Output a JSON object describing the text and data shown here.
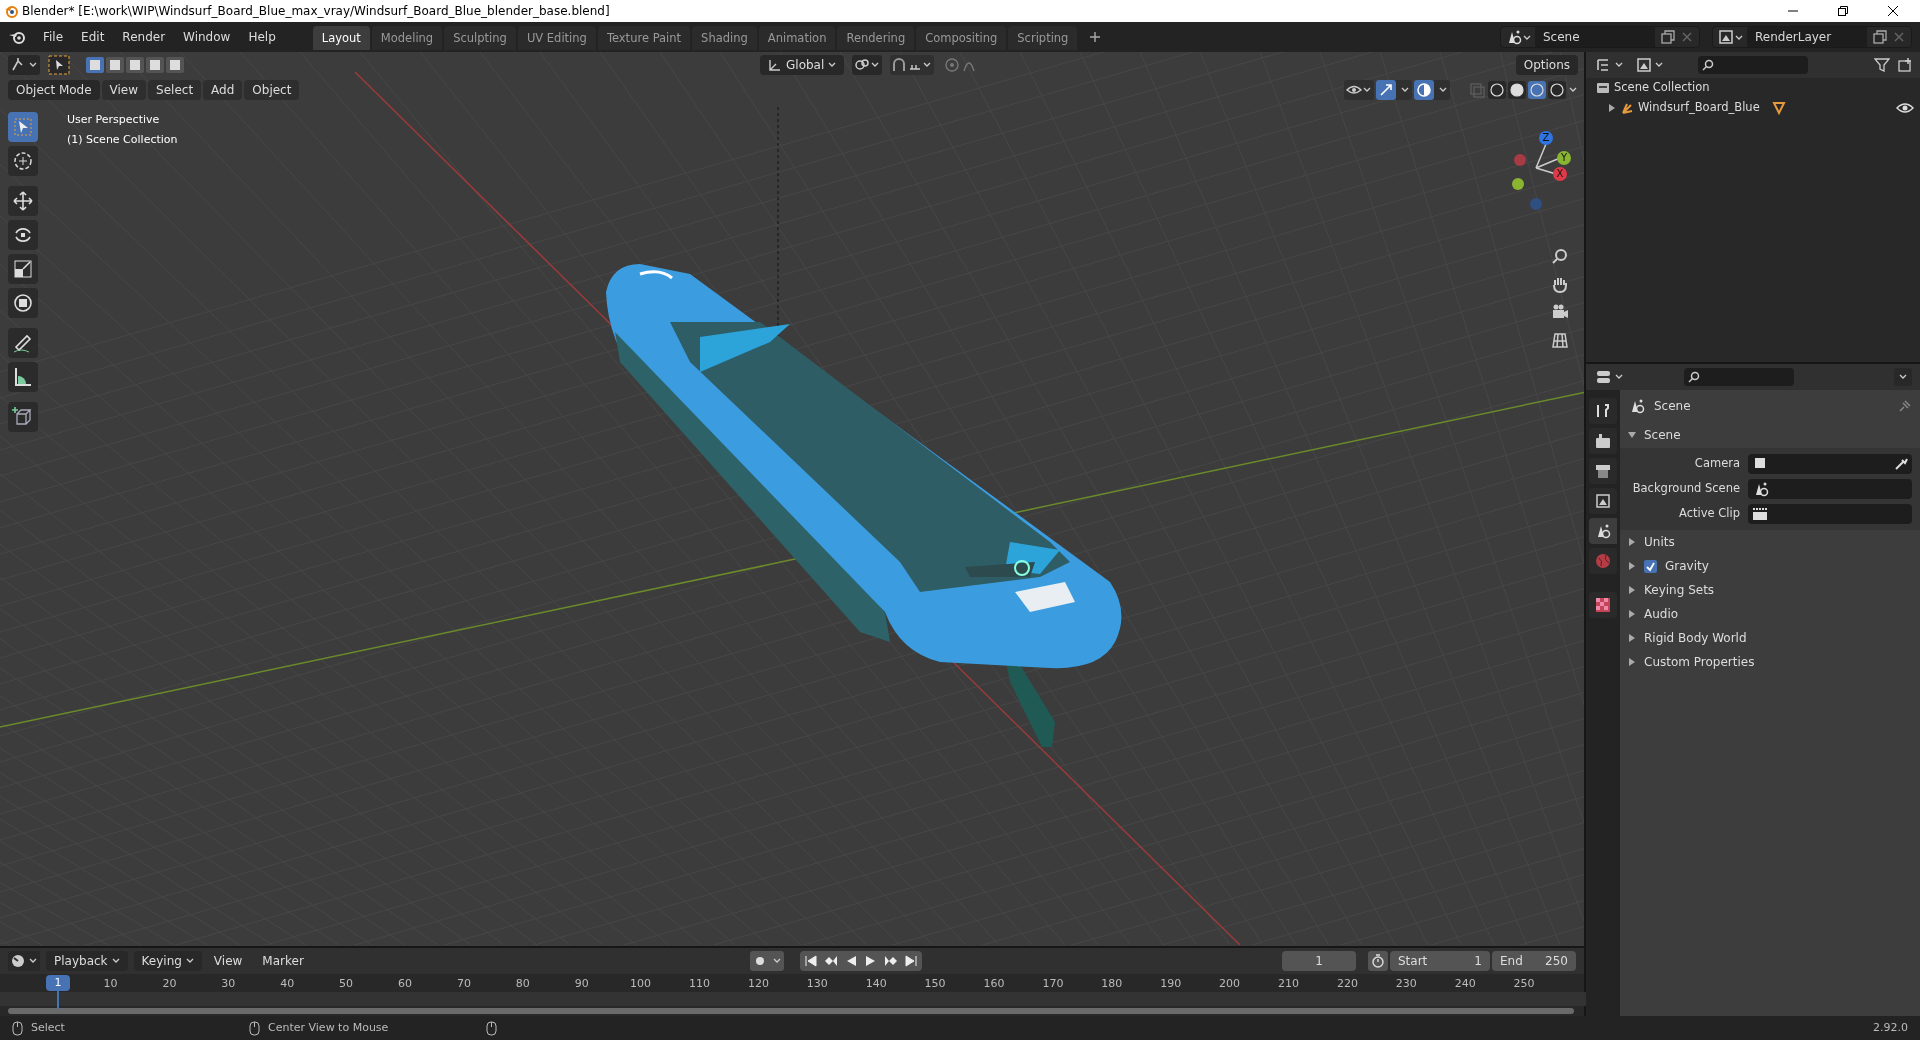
{
  "window": {
    "title": "Blender* [E:\\work\\WIP\\Windsurf_Board_Blue_max_vray/Windsurf_Board_Blue_blender_base.blend]"
  },
  "menu": [
    "File",
    "Edit",
    "Render",
    "Window",
    "Help"
  ],
  "workspaces": [
    {
      "label": "Layout",
      "selected": true
    },
    {
      "label": "Modeling",
      "selected": false
    },
    {
      "label": "Sculpting",
      "selected": false
    },
    {
      "label": "UV Editing",
      "selected": false
    },
    {
      "label": "Texture Paint",
      "selected": false
    },
    {
      "label": "Shading",
      "selected": false
    },
    {
      "label": "Animation",
      "selected": false
    },
    {
      "label": "Rendering",
      "selected": false
    },
    {
      "label": "Compositing",
      "selected": false
    },
    {
      "label": "Scripting",
      "selected": false
    }
  ],
  "scene_selector": {
    "value": "Scene"
  },
  "view_layer": {
    "value": "RenderLayer"
  },
  "tool_header": {
    "orientation": "Global",
    "options": "Options"
  },
  "viewport_header": {
    "mode": "Object Mode",
    "menus": [
      "View",
      "Select",
      "Add",
      "Object"
    ]
  },
  "viewport": {
    "overlay_lines": [
      "User Perspective",
      "(1) Scene Collection"
    ],
    "gizmo_axes": [
      "Z",
      "Y",
      "X"
    ]
  },
  "tools": [
    {
      "kind": "select",
      "selected": true
    },
    {
      "kind": "cursor",
      "selected": false
    },
    {
      "kind": "move",
      "selected": false
    },
    {
      "kind": "rotate",
      "selected": false
    },
    {
      "kind": "scale",
      "selected": false
    },
    {
      "kind": "transform",
      "selected": false
    },
    {
      "kind": "annotate",
      "selected": false
    },
    {
      "kind": "measure",
      "selected": false
    },
    {
      "kind": "add-cube",
      "selected": false
    }
  ],
  "outliner": {
    "items": [
      {
        "label": "Scene Collection",
        "children": [
          {
            "label": "Windsurf_Board_Blue",
            "expanded": false
          }
        ]
      }
    ]
  },
  "properties": {
    "header": "Scene",
    "tabs": [
      {
        "kind": "tool",
        "selected": false
      },
      {
        "kind": "render",
        "selected": false
      },
      {
        "kind": "output",
        "selected": false
      },
      {
        "kind": "view-layer",
        "selected": false
      },
      {
        "kind": "scene",
        "selected": true
      },
      {
        "kind": "world",
        "selected": false
      },
      {
        "kind": "texture",
        "selected": false
      }
    ],
    "panel": {
      "title": "Scene",
      "expanded": true,
      "fields": [
        {
          "label": "Camera",
          "kind": "camera"
        },
        {
          "label": "Background Scene",
          "kind": "scene"
        },
        {
          "label": "Active Clip",
          "kind": "clip"
        }
      ]
    },
    "subpanels": [
      {
        "label": "Units",
        "kind": "plain",
        "expanded": false
      },
      {
        "label": "Gravity",
        "kind": "checkbox",
        "checked": true,
        "expanded": false
      },
      {
        "label": "Keying Sets",
        "kind": "plain",
        "expanded": false
      },
      {
        "label": "Audio",
        "kind": "plain",
        "expanded": false
      },
      {
        "label": "Rigid Body World",
        "kind": "plain",
        "expanded": false
      },
      {
        "label": "Custom Properties",
        "kind": "plain",
        "expanded": false
      }
    ]
  },
  "timeline": {
    "menus": [
      "Playback",
      "Keying",
      "View",
      "Marker"
    ],
    "current_frame": "1",
    "start": {
      "label": "Start",
      "value": "1"
    },
    "end": {
      "label": "End",
      "value": "250"
    },
    "playhead": "1",
    "ruler": [
      "10",
      "20",
      "30",
      "40",
      "50",
      "60",
      "70",
      "80",
      "90",
      "100",
      "110",
      "120",
      "130",
      "140",
      "150",
      "160",
      "170",
      "180",
      "190",
      "200",
      "210",
      "220",
      "230",
      "240",
      "250"
    ]
  },
  "status_bar": {
    "hints": [
      "Select",
      "Center View to Mouse"
    ],
    "version": "2.92.0"
  }
}
